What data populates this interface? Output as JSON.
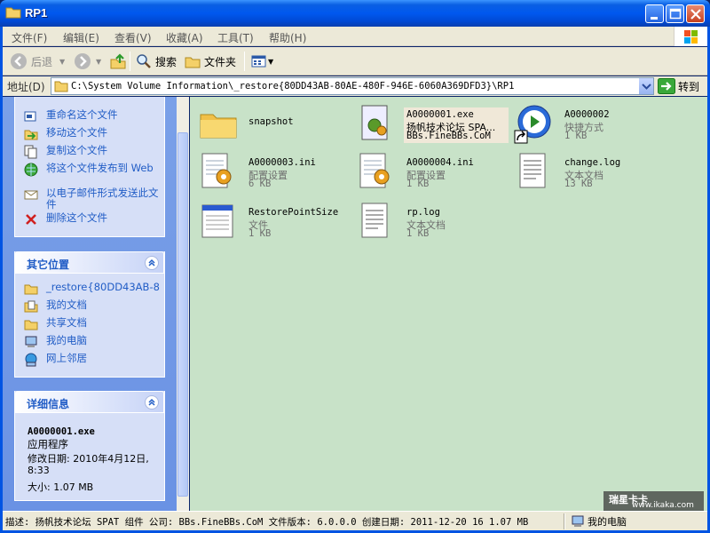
{
  "window": {
    "title": "RP1",
    "accent": "#0058ee"
  },
  "menu": {
    "items": [
      "文件(F)",
      "编辑(E)",
      "查看(V)",
      "收藏(A)",
      "工具(T)",
      "帮助(H)"
    ]
  },
  "toolbar": {
    "back_label": "后退",
    "search_label": "搜索",
    "folders_label": "文件夹"
  },
  "address": {
    "label": "地址(D)",
    "value": "C:\\System Volume Information\\_restore{80DD43AB-80AE-480F-946E-6060A369DFD3}\\RP1",
    "go_label": "转到"
  },
  "taskpane": {
    "file_tasks": [
      {
        "icon": "rename-icon",
        "label": "重命名这个文件"
      },
      {
        "icon": "move-icon",
        "label": "移动这个文件"
      },
      {
        "icon": "copy-icon",
        "label": "复制这个文件"
      },
      {
        "icon": "publish-web-icon",
        "label": "将这个文件发布到 Web"
      },
      {
        "icon": "email-icon",
        "label": "以电子邮件形式发送此文件"
      },
      {
        "icon": "delete-icon",
        "label": "删除这个文件"
      }
    ],
    "other_places": {
      "title": "其它位置",
      "items": [
        {
          "icon": "folder-icon",
          "label": "_restore{80DD43AB-8"
        },
        {
          "icon": "my-documents-icon",
          "label": "我的文档"
        },
        {
          "icon": "shared-documents-icon",
          "label": "共享文档"
        },
        {
          "icon": "my-computer-icon",
          "label": "我的电脑"
        },
        {
          "icon": "network-places-icon",
          "label": "网上邻居"
        }
      ]
    },
    "details": {
      "title": "详细信息",
      "name": "A0000001.exe",
      "type": "应用程序",
      "modified_label": "修改日期: 2010年4月12日, 8:33",
      "size_label": "大小: 1.07 MB"
    }
  },
  "files": [
    {
      "name": "snapshot",
      "type": "",
      "size": "",
      "icon": "folder-icon"
    },
    {
      "name": "A0000001.exe",
      "type": "扬帆技术论坛 SPA...",
      "size": "BBs.FineBBs.CoM",
      "icon": "application-icon",
      "selected": true
    },
    {
      "name": "A0000002",
      "type": "快捷方式",
      "size": "1 KB",
      "icon": "media-player-shortcut-icon"
    },
    {
      "name": "A0000003.ini",
      "type": "配置设置",
      "size": "6 KB",
      "icon": "ini-settings-icon"
    },
    {
      "name": "A0000004.ini",
      "type": "配置设置",
      "size": "1 KB",
      "icon": "ini-settings-icon"
    },
    {
      "name": "change.log",
      "type": "文本文档",
      "size": "13 KB",
      "icon": "text-document-icon"
    },
    {
      "name": "RestorePointSize",
      "type": "文件",
      "size": "1 KB",
      "icon": "generic-file-icon"
    },
    {
      "name": "rp.log",
      "type": "文本文档",
      "size": "1 KB",
      "icon": "text-document-icon"
    }
  ],
  "status": {
    "text": "描述: 扬帆技术论坛 SPAT 组件 公司: BBs.FineBBs.CoM 文件版本: 6.0.0.0 创建日期: 2011-12-20 16 1.07 MB",
    "location": "我的电脑"
  },
  "watermark": {
    "line1": "瑞星卡卡",
    "line2": "www.ikaka.com"
  }
}
